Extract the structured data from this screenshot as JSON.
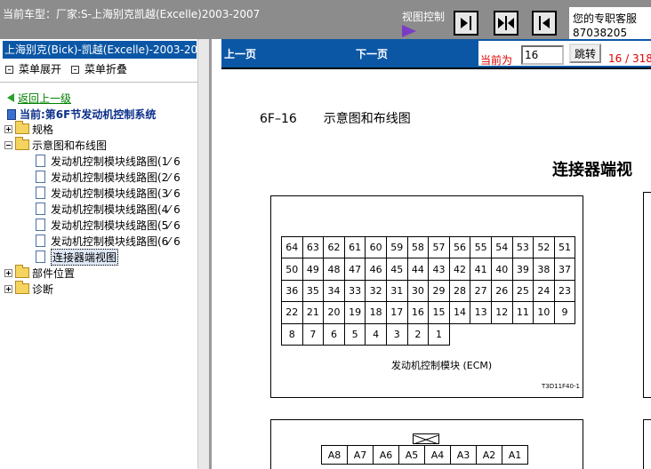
{
  "topbar": {
    "car_title": "当前车型：厂家:S-上海别克凯越(Excelle)2003-2007",
    "view_control_label": "视图控制",
    "service_label": "您的专职客服",
    "service_phone": "87038205"
  },
  "sidebar": {
    "header": "上海别克(Bick)-凯越(Excelle)-2003-20",
    "expand_all": "菜单展开",
    "collapse_all": "菜单折叠",
    "back": "返回上一级",
    "current_section": "当前:第6F节发动机控制系统",
    "tree": [
      {
        "label": "规格",
        "state": "collapsed"
      },
      {
        "label": "示意图和布线图",
        "state": "expanded",
        "children": [
          {
            "label": "发动机控制模块线路图(1⁄ 6"
          },
          {
            "label": "发动机控制模块线路图(2⁄ 6"
          },
          {
            "label": "发动机控制模块线路图(3⁄ 6"
          },
          {
            "label": "发动机控制模块线路图(4⁄ 6"
          },
          {
            "label": "发动机控制模块线路图(5⁄ 6"
          },
          {
            "label": "发动机控制模块线路图(6⁄ 6"
          },
          {
            "label": "连接器端视图",
            "selected": true
          }
        ]
      },
      {
        "label": "部件位置",
        "state": "collapsed"
      },
      {
        "label": "诊断",
        "state": "collapsed"
      }
    ]
  },
  "nav": {
    "prev": "上一页",
    "next": "下一页",
    "current_label": "当前为",
    "page_value": "16",
    "jump": "跳转",
    "page_count": "16 / 318"
  },
  "document": {
    "page_code": "6F–16",
    "page_heading": "示意图和布线图",
    "subtitle": "连接器端视",
    "ecm_label": "发动机控制模块 (ECM)",
    "figure_code": "T3D11F40-1",
    "ecm_pins": [
      [
        "64",
        "63",
        "62",
        "61",
        "60",
        "59",
        "58",
        "57",
        "56",
        "55",
        "54",
        "53",
        "52",
        "51",
        "50",
        "49"
      ],
      [
        "48",
        "47",
        "46",
        "45",
        "44",
        "43",
        "42",
        "41",
        "40",
        "39",
        "38",
        "37",
        "36",
        "35",
        "34",
        "33"
      ],
      [
        "32",
        "31",
        "30",
        "29",
        "28",
        "27",
        "26",
        "25",
        "24",
        "23",
        "22",
        "21",
        "20",
        "19",
        "18",
        "17"
      ],
      [
        "16",
        "15",
        "14",
        "13",
        "12",
        "11",
        "10",
        "9",
        "8",
        "7",
        "6",
        "5",
        "4",
        "3",
        "2",
        "1"
      ]
    ],
    "connector2_pins": [
      [
        "A8",
        "A7",
        "A6",
        "A5",
        "A4",
        "A3",
        "A2",
        "A1"
      ]
    ]
  }
}
